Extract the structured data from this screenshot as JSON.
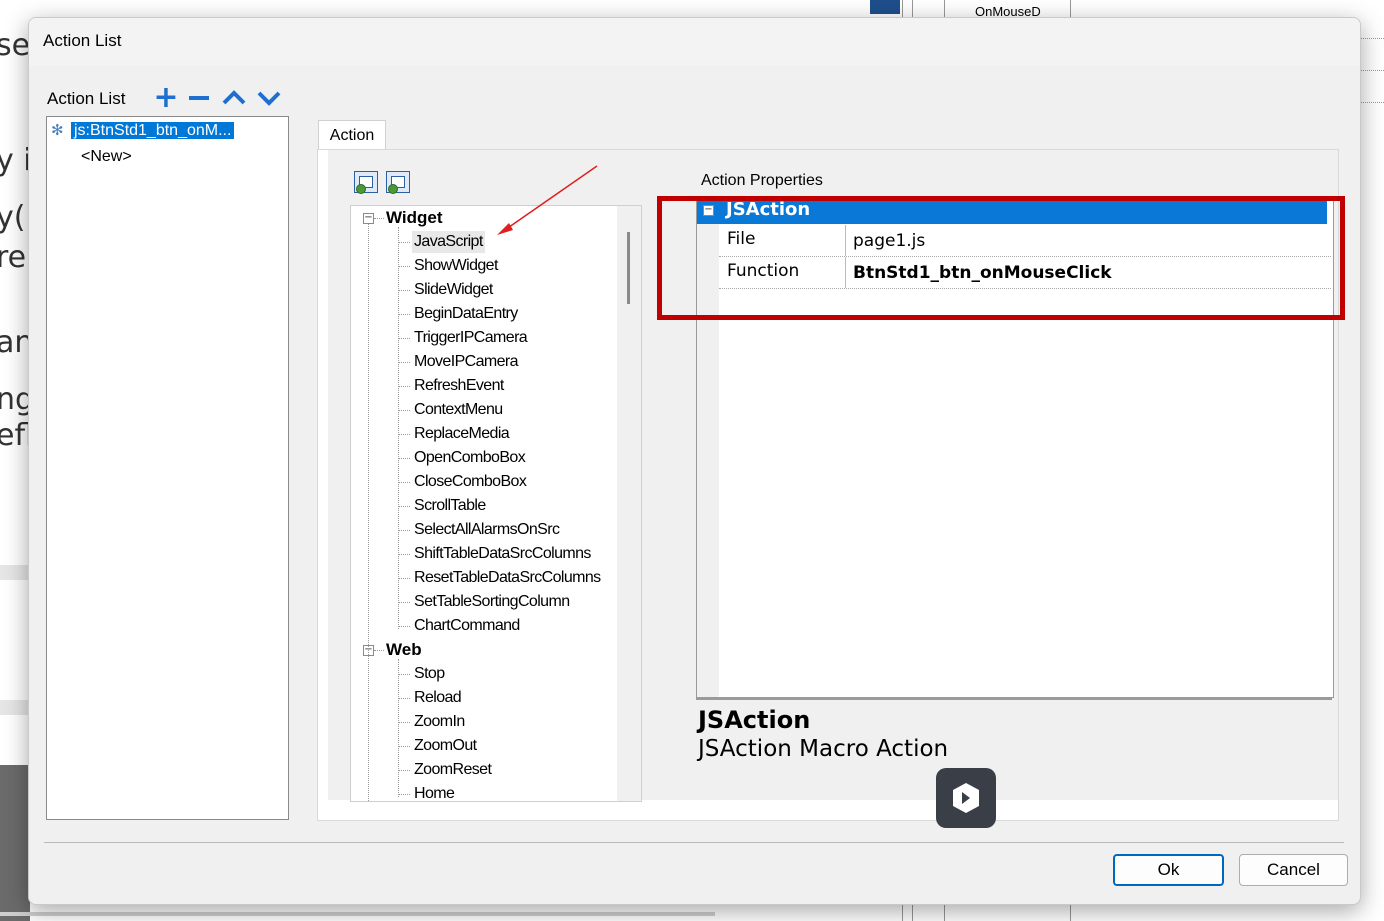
{
  "background": {
    "text_fragments": [
      "se",
      "y i",
      "y(",
      "re",
      "an",
      "ng",
      "efl",
      "OnMouseD"
    ]
  },
  "dialog": {
    "title": "Action List",
    "action_list_label": "Action List",
    "toolbar": {
      "add_icon": "+",
      "remove_icon": "−",
      "up_icon": "⌃",
      "down_icon": "⌄"
    },
    "action_items": [
      {
        "label": "js:BtnStd1_btn_onM..."
      },
      {
        "label": "<New>"
      }
    ],
    "tab_label": "Action",
    "tree": {
      "groups": [
        {
          "label": "Widget",
          "items": [
            "JavaScript",
            "ShowWidget",
            "SlideWidget",
            "BeginDataEntry",
            "TriggerIPCamera",
            "MoveIPCamera",
            "RefreshEvent",
            "ContextMenu",
            "ReplaceMedia",
            "OpenComboBox",
            "CloseComboBox",
            "ScrollTable",
            "SelectAllAlarmsOnSrc",
            "ShiftTableDataSrcColumns",
            "ResetTableDataSrcColumns",
            "SetTableSortingColumn",
            "ChartCommand"
          ]
        },
        {
          "label": "Web",
          "items": [
            "Stop",
            "Reload",
            "ZoomIn",
            "ZoomOut",
            "ZoomReset",
            "Home"
          ]
        }
      ],
      "expander_symbol": "−"
    },
    "properties": {
      "label": "Action Properties",
      "category": "JSAction",
      "rows": [
        {
          "name": "File",
          "value": "page1.js"
        },
        {
          "name": "Function",
          "value": "BtnStd1_btn_onMouseClick"
        }
      ]
    },
    "description": {
      "title": "JSAction",
      "text": "JSAction Macro Action"
    },
    "buttons": {
      "ok": "Ok",
      "cancel": "Cancel"
    }
  },
  "colors": {
    "accent": "#0a78d7",
    "highlight_box": "#c00000",
    "selection": "#0078d7"
  }
}
